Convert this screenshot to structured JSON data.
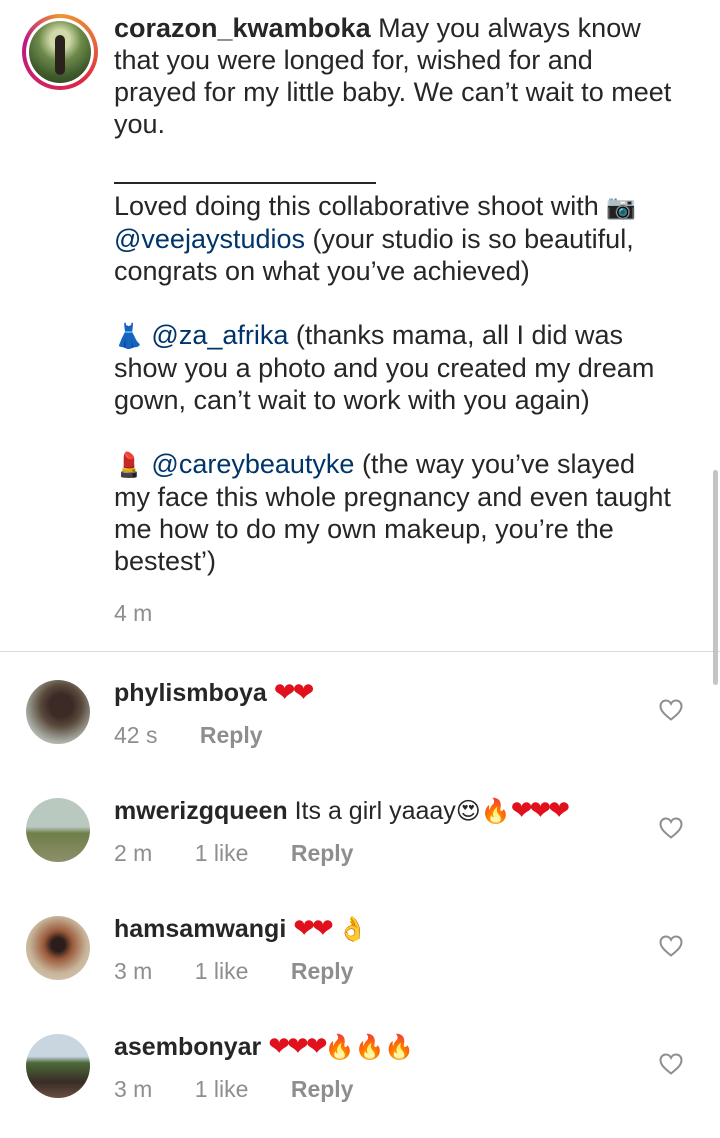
{
  "caption": {
    "username": "corazon_kwamboka",
    "intro": "May you always know that you were longed for, wished for and prayed for my little baby. We can’t wait to meet you.",
    "collab_text": "Loved doing this collaborative shoot with",
    "camera_emoji": "📷",
    "mention1": "@veejaystudios",
    "mention1_text": "(your studio is so beautiful, congrats on what you’ve achieved)",
    "dress_emoji": "👗",
    "mention2": "@za_afrika",
    "mention2_text": "(thanks mama, all I did was show you a photo and you created my dream gown, can’t wait to work with you again)",
    "lipstick_emoji": "💄",
    "mention3": "@careybeautyke",
    "mention3_text": "(the way you’ve slayed my face this whole pregnancy and even taught me how to do my own makeup, you’re the bestest’)",
    "time": "4 m"
  },
  "comments": [
    {
      "username": "phylismboya",
      "hearts": "❤❤",
      "text": "",
      "extra": "",
      "fires": "",
      "time": "42 s",
      "likes": "",
      "reply": "Reply"
    },
    {
      "username": "mwerizgqueen",
      "text": "Its a girl yaaay",
      "extra": "😍",
      "fires": "🔥",
      "hearts": "❤❤❤",
      "time": "2 m",
      "likes": "1 like",
      "reply": "Reply"
    },
    {
      "username": "hamsamwangi",
      "hearts": "❤❤",
      "text": "",
      "extra": "👌",
      "fires": "",
      "time": "3 m",
      "likes": "1 like",
      "reply": "Reply"
    },
    {
      "username": "asembonyar",
      "hearts": "❤❤❤",
      "text": "",
      "extra": "",
      "fires": "🔥🔥🔥",
      "time": "3 m",
      "likes": "1 like",
      "reply": "Reply"
    }
  ],
  "icons": {
    "like": "heart-outline-icon"
  },
  "colors": {
    "mention": "#003569",
    "heart": "#e0101c",
    "meta": "#8e8e8e"
  }
}
